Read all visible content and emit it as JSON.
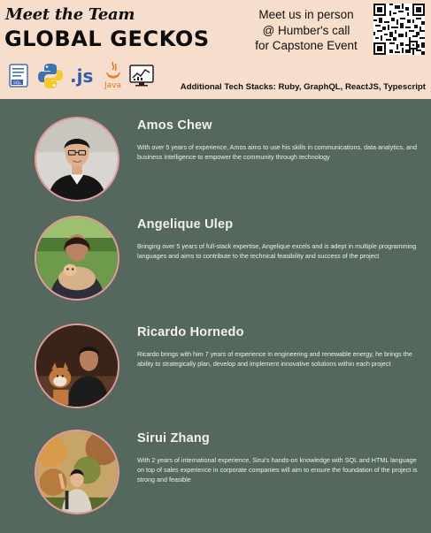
{
  "header": {
    "script_title": "Meet the Team",
    "team_name": "GLOBAL GECKOS",
    "event_lines": [
      "Meet us in person",
      "@ Humber's call",
      "for Capstone Event"
    ],
    "tech_stacks": "Additional Tech Stacks: Ruby, GraphQL, ReactJS, Typescript",
    "icons": [
      {
        "name": "sql-database-icon",
        "label": "SQL"
      },
      {
        "name": "python-icon",
        "label": ""
      },
      {
        "name": "javascript-icon",
        "label": ".js"
      },
      {
        "name": "java-icon",
        "label": "Java"
      },
      {
        "name": "data-analytics-icon",
        "label": ""
      }
    ]
  },
  "colors": {
    "background": "#54685e",
    "header_bg": "#f6ddcc",
    "avatar_border": "#e49a98",
    "javascript": "#2f5fa8",
    "java": "#e07a1f"
  },
  "members": [
    {
      "name": "Amos Chew",
      "bio": "With over 5 years of experience, Amos aims to use his skills in communications, data analytics, and business intelligence to empower the community through technology"
    },
    {
      "name": "Angelique Ulep",
      "bio": "Bringing over 5 years of full-stack expertise, Angelique excels and is adept in multiple programming languages and aims to contribute to the technical feasibility and success of the project"
    },
    {
      "name": "Ricardo Hornedo",
      "bio": "Ricardo brings with him 7 years of experience in engineering and renewable energy, he brings the ability to strategically plan, develop and implement innovative solutions within each project"
    },
    {
      "name": "Sirui Zhang",
      "bio": "With 2 years of international experience, Sirui's hands-on knowledge with SQL and HTML language on top of sales experience in corporate companies will aim to ensure the foundation of the project is strong and feasible"
    }
  ]
}
